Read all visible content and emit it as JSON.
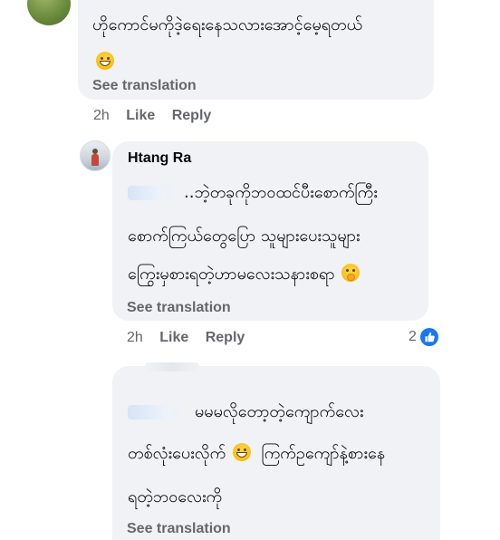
{
  "comments": [
    {
      "id": "comment-1",
      "lines": [
        "ဟိုကောင်မကိုဒဲ့ရေးနေသလားအောင့်မေ့ရတယ်"
      ],
      "emoji_line": "😁",
      "see_translation": "See translation",
      "time": "2h",
      "like": "Like",
      "reply": "Reply"
    },
    {
      "id": "comment-2",
      "author": "Htang Ra",
      "lines": [
        "..ဘဲ့တခုကိုဘဝထင်ပီးစောက်ကြီး",
        "စောက်ကြယ်တွေပြော သူများပေးသူများ",
        "ကြွေးမှစားရတဲ့ဟာမလေးသနားစရာ"
      ],
      "see_translation": "See translation",
      "time": "2h",
      "like": "Like",
      "reply": "Reply",
      "reaction_count": "2"
    },
    {
      "id": "comment-3",
      "lines": [
        "မမမလိုတော့တဲ့ကျောက်လေး",
        "တစ်လုံးပေးလိုက်",
        "ကြက်ဥကျော်နဲ့စားနေ",
        "ရတဲ့ဘဝလေးကို"
      ],
      "see_translation": "See translation"
    }
  ],
  "icons": {
    "grin_emoji": "grinning-face-emoji",
    "hand_over_mouth_emoji": "face-with-hand-over-mouth-emoji",
    "like_reaction": "like-reaction-icon"
  },
  "colors": {
    "bubble_bg": "#f0f2f5",
    "meta_text": "#65676b",
    "like_blue": "#1877f2"
  }
}
